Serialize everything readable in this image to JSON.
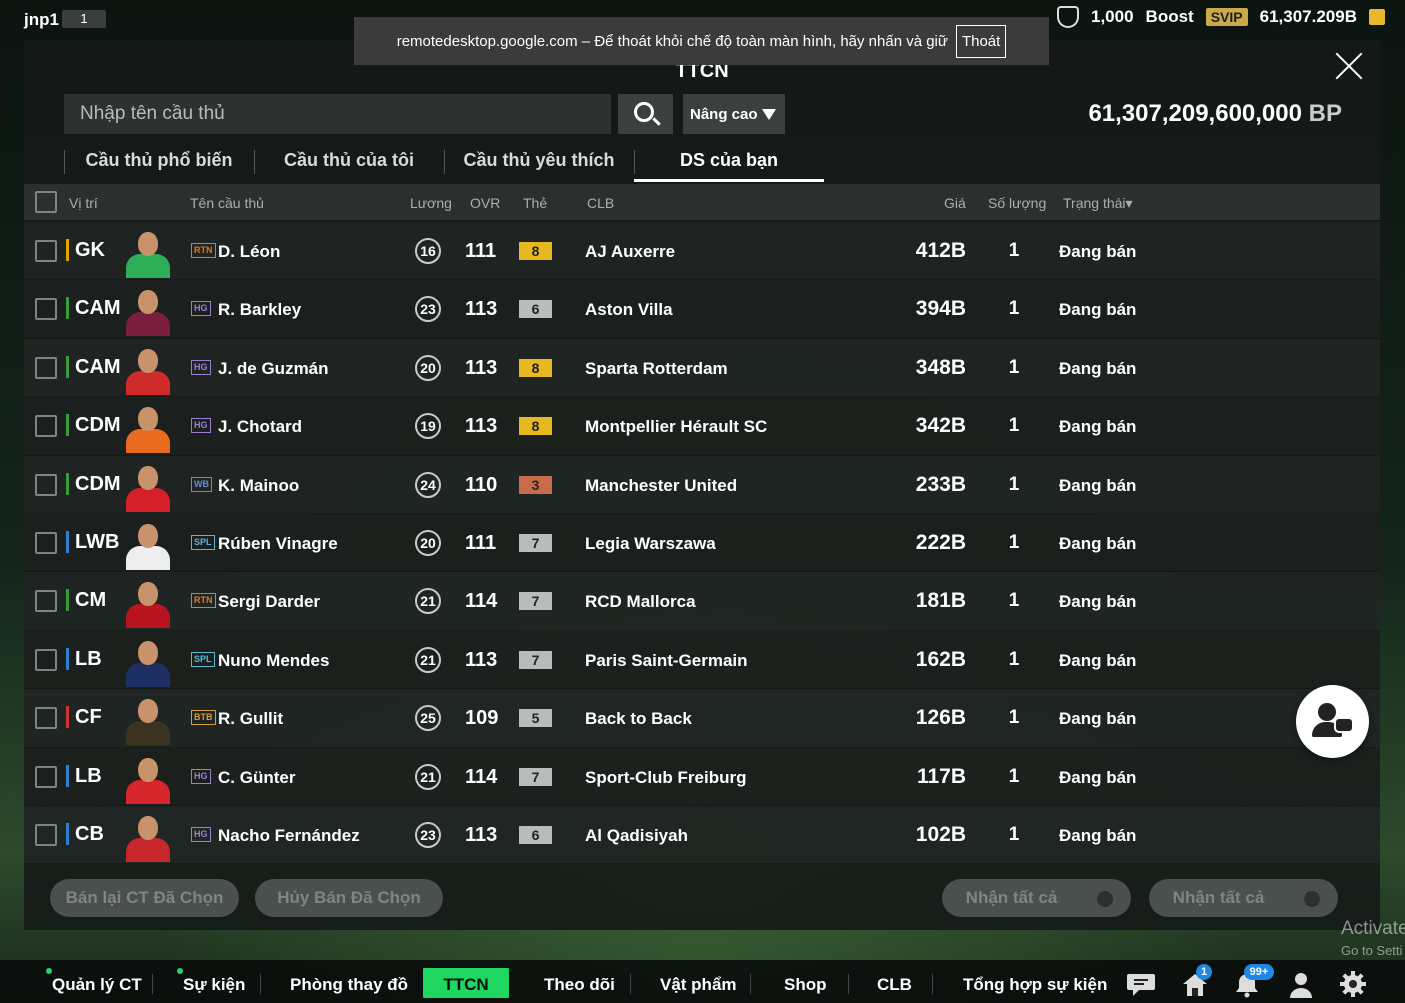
{
  "topbar": {
    "username": "jnp1",
    "level": "1",
    "currency_1": "1,000",
    "boost_label": "Boost",
    "svip_label": "SVIP",
    "balance": "61,307.209B"
  },
  "rdp_banner": {
    "message": "remotedesktop.google.com – Để thoát khỏi chế độ toàn màn hình, hãy nhấn và giữ",
    "exit_label": "Thoát"
  },
  "panel": {
    "title": "TTCN",
    "search_placeholder": "Nhập tên cầu thủ",
    "advanced_label": "Nâng cao",
    "bp_amount": "61,307,209,600,000",
    "bp_unit": "BP"
  },
  "tabs": [
    {
      "label": "Cầu thủ phổ biến",
      "active": false
    },
    {
      "label": "Cầu thủ của tôi",
      "active": false
    },
    {
      "label": "Cầu thủ yêu thích",
      "active": false
    },
    {
      "label": "DS của bạn",
      "active": true
    }
  ],
  "table": {
    "headers": {
      "position": "Vị trí",
      "name": "Tên cầu thủ",
      "wage": "Lương",
      "ovr": "OVR",
      "grade": "Thẻ",
      "club": "CLB",
      "price": "Giá",
      "qty": "Số lượng",
      "status": "Trạng thái▾"
    },
    "rows": [
      {
        "pos": "GK",
        "pos_group": "gk",
        "season": "RTN",
        "season_color": "#e07a2a",
        "name": "D. Léon",
        "wage": "16",
        "ovr": "111",
        "grade": "8",
        "grade_color": "#e8b820",
        "club": "AJ Auxerre",
        "price": "412B",
        "qty": "1",
        "status": "Đang bán",
        "kit_color": "#2fae5a"
      },
      {
        "pos": "CAM",
        "pos_group": "mid",
        "season": "HG",
        "season_color": "#9b7fd4",
        "name": "R. Barkley",
        "wage": "23",
        "ovr": "113",
        "grade": "6",
        "grade_color": "#b8bdbb",
        "club": "Aston Villa",
        "price": "394B",
        "qty": "1",
        "status": "Đang bán",
        "kit_color": "#7a1e3d"
      },
      {
        "pos": "CAM",
        "pos_group": "mid",
        "season": "HG",
        "season_color": "#9b7fd4",
        "name": "J. de Guzmán",
        "wage": "20",
        "ovr": "113",
        "grade": "8",
        "grade_color": "#e8b820",
        "club": "Sparta Rotterdam",
        "price": "348B",
        "qty": "1",
        "status": "Đang bán",
        "kit_color": "#d02b2b"
      },
      {
        "pos": "CDM",
        "pos_group": "mid",
        "season": "HG",
        "season_color": "#9b7fd4",
        "name": "J. Chotard",
        "wage": "19",
        "ovr": "113",
        "grade": "8",
        "grade_color": "#e8b820",
        "club": "Montpellier Hérault SC",
        "price": "342B",
        "qty": "1",
        "status": "Đang bán",
        "kit_color": "#e86b1f"
      },
      {
        "pos": "CDM",
        "pos_group": "mid",
        "season": "WB",
        "season_color": "#5f8fe0",
        "name": "K. Mainoo",
        "wage": "24",
        "ovr": "110",
        "grade": "3",
        "grade_color": "#c86b4a",
        "club": "Manchester United",
        "price": "233B",
        "qty": "1",
        "status": "Đang bán",
        "kit_color": "#d41f2b"
      },
      {
        "pos": "LWB",
        "pos_group": "def",
        "season": "SPL",
        "season_color": "#5ab8d8",
        "name": "Rúben Vinagre",
        "wage": "20",
        "ovr": "111",
        "grade": "7",
        "grade_color": "#b8bdbb",
        "club": "Legia Warszawa",
        "price": "222B",
        "qty": "1",
        "status": "Đang bán",
        "kit_color": "#eeeeee"
      },
      {
        "pos": "CM",
        "pos_group": "mid",
        "season": "RTN",
        "season_color": "#e07a2a",
        "name": "Sergi Darder",
        "wage": "21",
        "ovr": "114",
        "grade": "7",
        "grade_color": "#b8bdbb",
        "club": "RCD Mallorca",
        "price": "181B",
        "qty": "1",
        "status": "Đang bán",
        "kit_color": "#b8141f"
      },
      {
        "pos": "LB",
        "pos_group": "def",
        "season": "SPL",
        "season_color": "#5ab8d8",
        "name": "Nuno Mendes",
        "wage": "21",
        "ovr": "113",
        "grade": "7",
        "grade_color": "#b8bdbb",
        "club": "Paris Saint-Germain",
        "price": "162B",
        "qty": "1",
        "status": "Đang bán",
        "kit_color": "#1d2f63"
      },
      {
        "pos": "CF",
        "pos_group": "fwd",
        "season": "BTB",
        "season_color": "#e09a3a",
        "name": "R. Gullit",
        "wage": "25",
        "ovr": "109",
        "grade": "5",
        "grade_color": "#b8bdbb",
        "club": "Back to Back",
        "price": "126B",
        "qty": "1",
        "status": "Đang bán",
        "kit_color": "#3b3320"
      },
      {
        "pos": "LB",
        "pos_group": "def",
        "season": "HG",
        "season_color": "#9b7fd4",
        "name": "C. Günter",
        "wage": "21",
        "ovr": "114",
        "grade": "7",
        "grade_color": "#b8bdbb",
        "club": "Sport-Club Freiburg",
        "price": "117B",
        "qty": "1",
        "status": "Đang bán",
        "kit_color": "#d7262b"
      },
      {
        "pos": "CB",
        "pos_group": "def",
        "season": "HG",
        "season_color": "#9b7fd4",
        "name": "Nacho Fernández",
        "wage": "23",
        "ovr": "113",
        "grade": "6",
        "grade_color": "#b8bdbb",
        "club": "Al Qadisiyah",
        "price": "102B",
        "qty": "1",
        "status": "Đang bán",
        "kit_color": "#c7262b"
      }
    ]
  },
  "actions": {
    "resell_label": "Bán lại CT Đã Chọn",
    "cancel_label": "Hủy Bán Đã Chọn",
    "claim_all_label_1": "Nhận tất cả",
    "claim_all_label_2": "Nhận tất cả"
  },
  "watermark": {
    "line1": "Activate",
    "line2": "Go to Setti"
  },
  "navbar": {
    "items": [
      "Quản lý CT",
      "Sự kiện",
      "Phòng thay đồ",
      "TTCN",
      "Theo dõi",
      "Vật phẩm",
      "Shop",
      "CLB",
      "Tổng hợp sự kiện"
    ],
    "home_badge": "1",
    "notif_badge": "99+"
  },
  "colors": {
    "accent_green": "#1ed760",
    "panel_bg": "#161a18",
    "row_bg": "#282d2b"
  }
}
